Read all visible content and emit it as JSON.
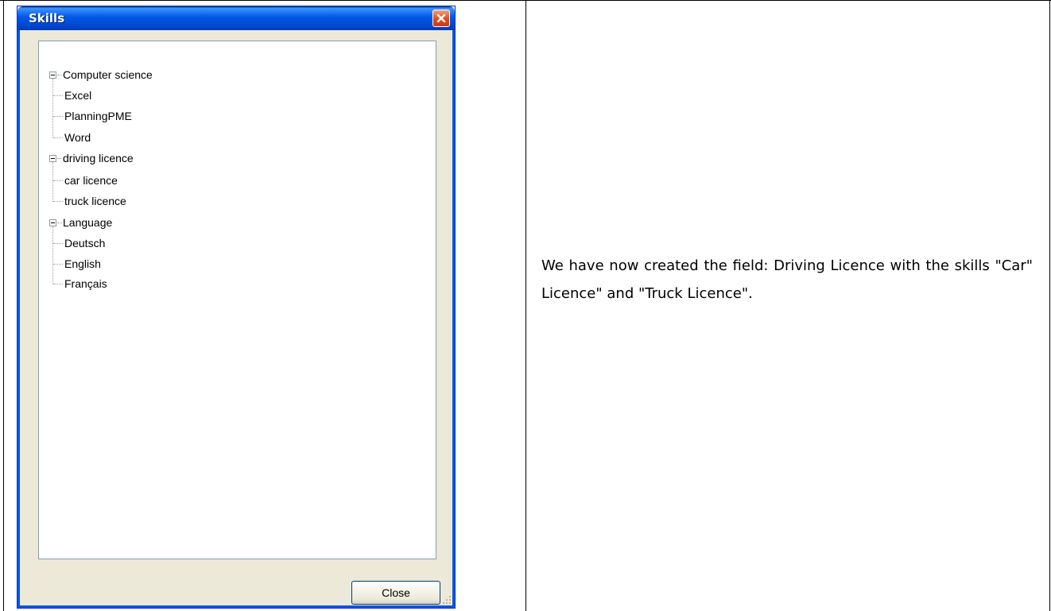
{
  "window": {
    "title": "Skills",
    "close_button_label": "Close"
  },
  "tree": {
    "groups": [
      {
        "label": "Computer science",
        "children": [
          "Excel",
          "PlanningPME",
          "Word"
        ]
      },
      {
        "label": "driving licence",
        "children": [
          "car licence",
          "truck licence"
        ]
      },
      {
        "label": "Language",
        "children": [
          "Deutsch",
          "English",
          "Français"
        ]
      }
    ]
  },
  "document": {
    "description": "We have now created the field: Driving Licence with the skills \"Car\" Licence\" and \"Truck Licence\"."
  },
  "icons": {
    "title_close": "close-x-icon",
    "expander": "tree-collapse-minus-icon",
    "grip": "resize-grip-icon"
  },
  "colors": {
    "titlebar": "#0058e6",
    "window_bg": "#ece9d8",
    "close_red": "#e04a1e"
  }
}
